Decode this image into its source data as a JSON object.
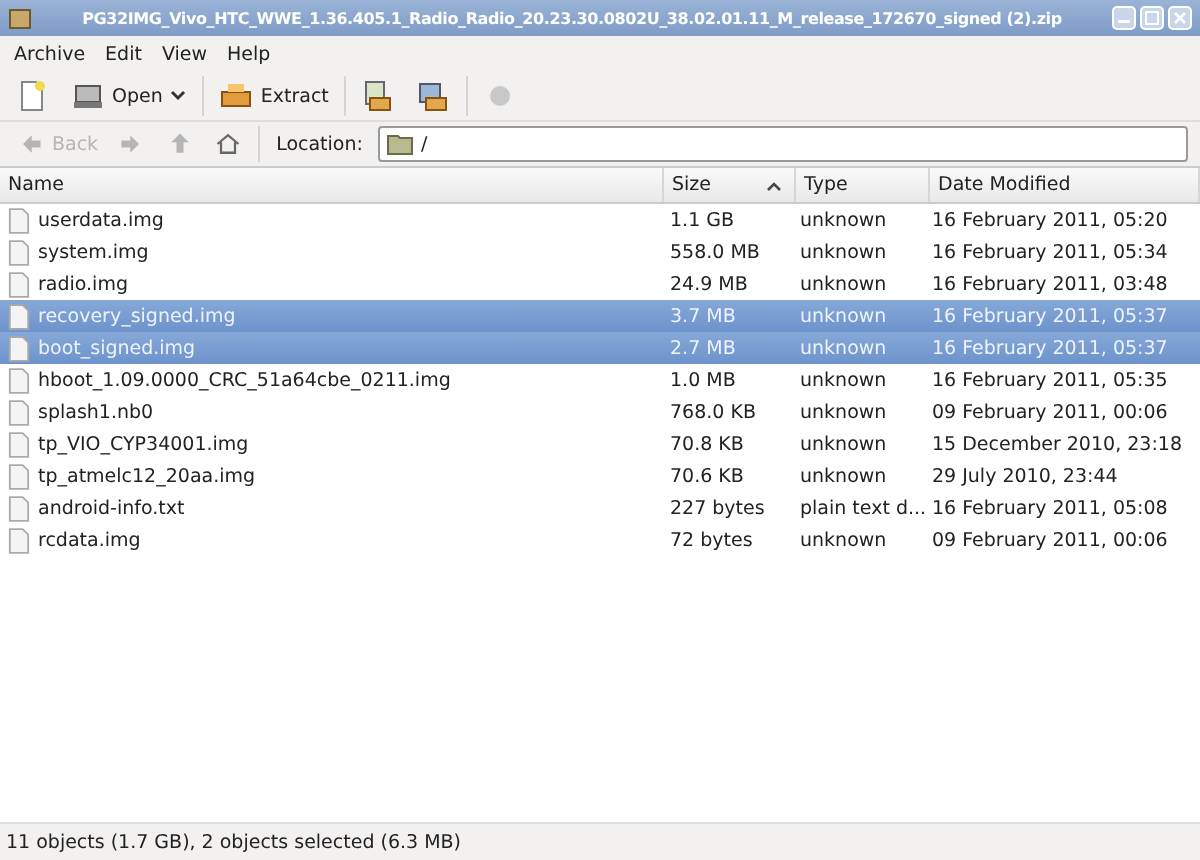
{
  "window": {
    "title": "PG32IMG_Vivo_HTC_WWE_1.36.405.1_Radio_Radio_20.23.30.0802U_38.02.01.11_M_release_172670_signed (2).zip"
  },
  "menu": [
    "Archive",
    "Edit",
    "View",
    "Help"
  ],
  "toolbar": [
    {
      "kind": "new"
    },
    {
      "kind": "open",
      "label": "Open"
    },
    {
      "kind": "extract",
      "label": "Extract"
    },
    {
      "kind": "add-files"
    },
    {
      "kind": "add-folder"
    },
    {
      "kind": "stop",
      "disabled": true
    }
  ],
  "navigation": {
    "back": {
      "label": "Back",
      "disabled": true
    },
    "forward": {
      "disabled": true
    },
    "up": {
      "disabled": true
    },
    "location_label": "Location:",
    "location": "/"
  },
  "table": {
    "columns": [
      {
        "label": "Name",
        "sorted": false
      },
      {
        "label": "Size",
        "sorted": true
      },
      {
        "label": "Type",
        "sorted": false
      },
      {
        "label": "Date Modified",
        "sorted": false
      }
    ],
    "rows": [
      {
        "name": "userdata.img",
        "size": "1.1 GB",
        "type": "unknown",
        "date": "16 February 2011, 05:20",
        "selected": false
      },
      {
        "name": "system.img",
        "size": "558.0 MB",
        "type": "unknown",
        "date": "16 February 2011, 05:34",
        "selected": false
      },
      {
        "name": "radio.img",
        "size": "24.9 MB",
        "type": "unknown",
        "date": "16 February 2011, 03:48",
        "selected": false
      },
      {
        "name": "recovery_signed.img",
        "size": "3.7 MB",
        "type": "unknown",
        "date": "16 February 2011, 05:37",
        "selected": true
      },
      {
        "name": "boot_signed.img",
        "size": "2.7 MB",
        "type": "unknown",
        "date": "16 February 2011, 05:37",
        "selected": true
      },
      {
        "name": "hboot_1.09.0000_CRC_51a64cbe_0211.img",
        "size": "1.0 MB",
        "type": "unknown",
        "date": "16 February 2011, 05:35",
        "selected": false
      },
      {
        "name": "splash1.nb0",
        "size": "768.0 KB",
        "type": "unknown",
        "date": "09 February 2011, 00:06",
        "selected": false
      },
      {
        "name": "tp_VIO_CYP34001.img",
        "size": "70.8 KB",
        "type": "unknown",
        "date": "15 December 2010, 23:18",
        "selected": false
      },
      {
        "name": "tp_atmelc12_20aa.img",
        "size": "70.6 KB",
        "type": "unknown",
        "date": "29 July 2010, 23:44",
        "selected": false
      },
      {
        "name": "android-info.txt",
        "size": "227 bytes",
        "type": "plain text d...",
        "date": "16 February 2011, 05:08",
        "selected": false
      },
      {
        "name": "rcdata.img",
        "size": "72 bytes",
        "type": "unknown",
        "date": "09 February 2011, 00:06",
        "selected": false
      }
    ]
  },
  "status_bar": "11 objects (1.7 GB), 2 objects selected (6.3 MB)"
}
